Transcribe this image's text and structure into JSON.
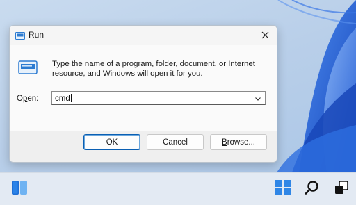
{
  "dialog": {
    "title": "Run",
    "description": "Type the name of a program, folder, document, or Internet resource, and Windows will open it for you.",
    "open_label_prefix": "O",
    "open_label_underline": "p",
    "open_label_suffix": "en:",
    "command_value": "cmd",
    "buttons": {
      "ok": "OK",
      "cancel": "Cancel",
      "browse_underline": "B",
      "browse_rest": "rowse..."
    }
  },
  "icons": {
    "title": "run-icon",
    "large": "run-icon",
    "close": "close-icon",
    "dropdown": "chevron-down-icon",
    "taskbar": [
      "widgets-icon",
      "start-icon",
      "search-icon",
      "task-view-icon"
    ]
  },
  "colors": {
    "accent": "#0a5fb3",
    "start_blue": "#2f86e6",
    "wallpaper_blue": "#1f5fd1"
  }
}
